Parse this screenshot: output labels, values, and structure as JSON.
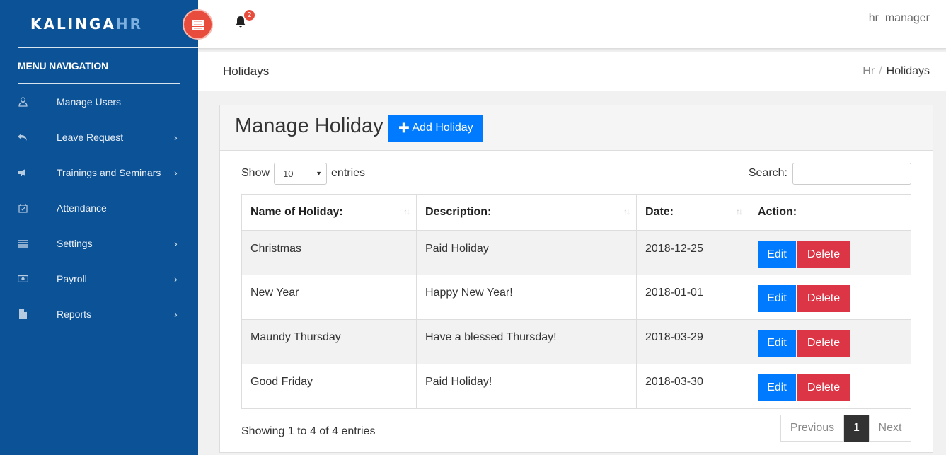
{
  "brand": {
    "main": "KALINGA",
    "accent": "HR"
  },
  "sidebar": {
    "menu_title": "MENU NAVIGATION",
    "items": [
      {
        "label": "Manage Users",
        "icon": "user-icon",
        "has_children": false
      },
      {
        "label": "Leave Request",
        "icon": "reply-icon",
        "has_children": true
      },
      {
        "label": "Trainings and Seminars",
        "icon": "megaphone-icon",
        "has_children": true
      },
      {
        "label": "Attendance",
        "icon": "calendar-check-icon",
        "has_children": false
      },
      {
        "label": "Settings",
        "icon": "list-icon",
        "has_children": true
      },
      {
        "label": "Payroll",
        "icon": "money-icon",
        "has_children": true
      },
      {
        "label": "Reports",
        "icon": "file-icon",
        "has_children": true
      }
    ]
  },
  "topbar": {
    "notification_count": "2",
    "user": "hr_manager"
  },
  "page": {
    "title": "Holidays",
    "breadcrumb": {
      "parent": "Hr",
      "separator": "/",
      "current": "Holidays"
    }
  },
  "card": {
    "title": "Manage Holiday",
    "add_button": "Add Holiday",
    "show_label": "Show",
    "entries_label": "entries",
    "page_size": "10",
    "search_label": "Search:",
    "search_value": "",
    "columns": [
      "Name of Holiday:",
      "Description:",
      "Date:",
      "Action:"
    ],
    "rows": [
      {
        "name": "Christmas",
        "description": "Paid Holiday",
        "date": "2018-12-25"
      },
      {
        "name": "New Year",
        "description": "Happy New Year!",
        "date": "2018-01-01"
      },
      {
        "name": "Maundy Thursday",
        "description": "Have a blessed Thursday!",
        "date": "2018-03-29"
      },
      {
        "name": "Good Friday",
        "description": "Paid Holiday!",
        "date": "2018-03-30"
      }
    ],
    "edit_label": "Edit",
    "delete_label": "Delete",
    "info": "Showing 1 to 4 of 4 entries",
    "pagination": {
      "previous": "Previous",
      "current": "1",
      "next": "Next"
    }
  },
  "colors": {
    "sidebar": "#0c5296",
    "primary": "#007bff",
    "danger": "#dc3545",
    "toggle": "#e74c3c"
  }
}
